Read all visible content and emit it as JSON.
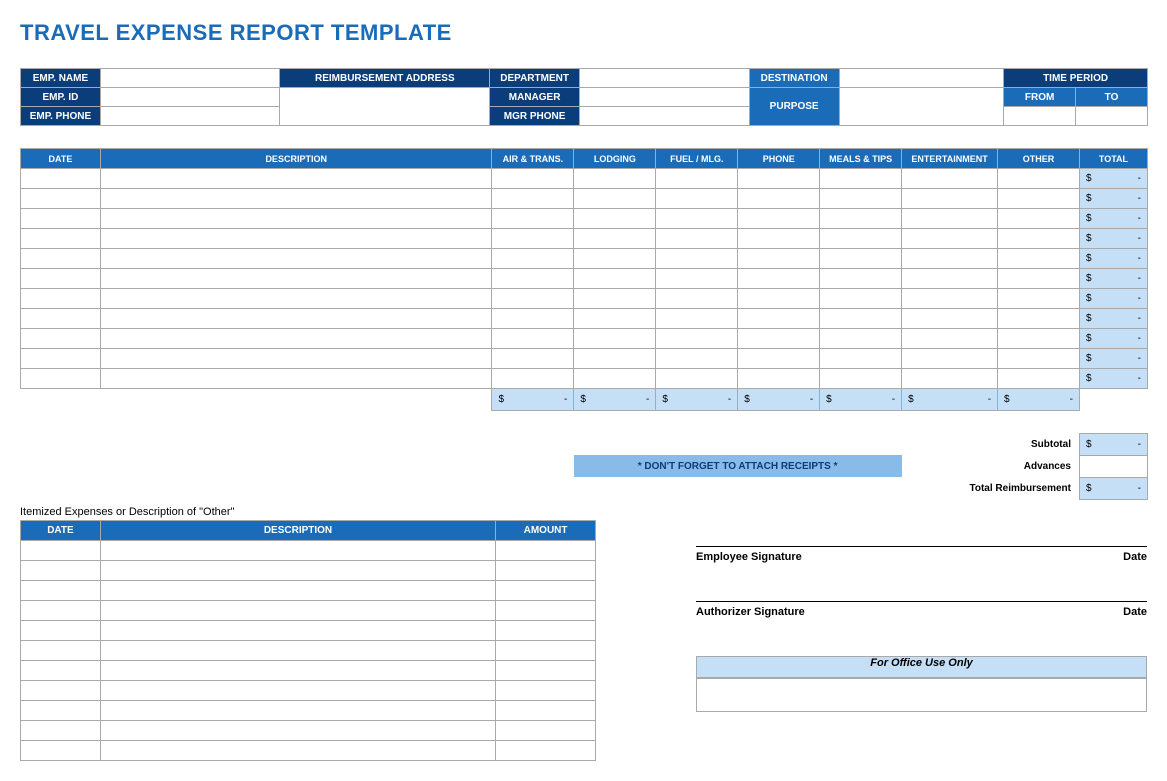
{
  "title": "TRAVEL EXPENSE REPORT TEMPLATE",
  "info": {
    "emp_name": "EMP. NAME",
    "emp_id": "EMP. ID",
    "emp_phone": "EMP. PHONE",
    "reimb_addr": "REIMBURSEMENT ADDRESS",
    "department": "DEPARTMENT",
    "manager": "MANAGER",
    "mgr_phone": "MGR PHONE",
    "destination": "DESTINATION",
    "purpose": "PURPOSE",
    "time_period": "TIME PERIOD",
    "from": "FROM",
    "to": "TO"
  },
  "main_headers": {
    "date": "DATE",
    "description": "DESCRIPTION",
    "air": "AIR & TRANS.",
    "lodging": "LODGING",
    "fuel": "FUEL / MLG.",
    "phone": "PHONE",
    "meals": "MEALS & TIPS",
    "entertainment": "ENTERTAINMENT",
    "other": "OTHER",
    "total": "TOTAL"
  },
  "currency": "$",
  "dash": "-",
  "row_totals": [
    "$",
    "$",
    "$",
    "$",
    "$",
    "$",
    "$",
    "$",
    "$",
    "$",
    "$"
  ],
  "receipts_note": "* DON'T FORGET TO ATTACH RECEIPTS *",
  "summary": {
    "subtotal": "Subtotal",
    "advances": "Advances",
    "total_reimb": "Total Reimbursement"
  },
  "itemized_caption": "Itemized Expenses or Description of \"Other\"",
  "item_headers": {
    "date": "DATE",
    "description": "DESCRIPTION",
    "amount": "AMOUNT"
  },
  "signatures": {
    "employee": "Employee Signature",
    "authorizer": "Authorizer Signature",
    "date": "Date"
  },
  "office_use": "For Office Use Only"
}
